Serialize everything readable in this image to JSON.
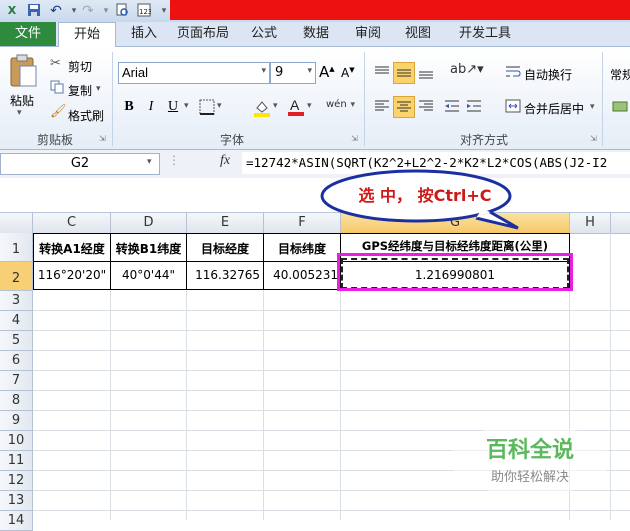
{
  "ribbon_tabs": [
    "文件",
    "开始",
    "插入",
    "页面布局",
    "公式",
    "数据",
    "审阅",
    "视图",
    "开发工具"
  ],
  "clipboard": {
    "paste": "粘贴",
    "cut": "剪切",
    "copy": "复制",
    "format_painter": "格式刷",
    "group": "剪贴板"
  },
  "font": {
    "name": "Arial",
    "size": "9",
    "group": "字体",
    "bold": "B",
    "italic": "I",
    "underline": "U",
    "wen": "wén",
    "big_a": "A",
    "small_a": "A"
  },
  "alignment": {
    "wrap": "自动换行",
    "merge": "合并后居中",
    "group": "对齐方式"
  },
  "number": {
    "format": "常规"
  },
  "namebox": "G2",
  "fx": "fx",
  "formula": "=12742*ASIN(SQRT(K2^2+L2^2-2*K2*L2*COS(ABS(J2-I2",
  "columns": [
    "C",
    "D",
    "E",
    "F",
    "G",
    "H"
  ],
  "rows": [
    "1",
    "2",
    "3",
    "4",
    "5",
    "6",
    "7",
    "8",
    "9",
    "10",
    "11",
    "12",
    "13",
    "14"
  ],
  "headers": [
    "转换A1经度",
    "转换B1纬度",
    "目标经度",
    "目标纬度",
    "GPS经纬度与目标经纬度距离(公里)"
  ],
  "data_row": [
    "116°20'20\"",
    "40°0'44\"",
    "116.32765",
    "40.005231",
    "1.216990801"
  ],
  "callout": "选 中， 按Ctrl+C",
  "watermark": {
    "title": "百科全说",
    "subtitle": "助你轻松解决"
  },
  "colors": {
    "file_tab": "#2e8b3d",
    "callout_border": "#1c2fa0",
    "highlight_border": "#e81ee0",
    "callout_text": "#d01818"
  }
}
